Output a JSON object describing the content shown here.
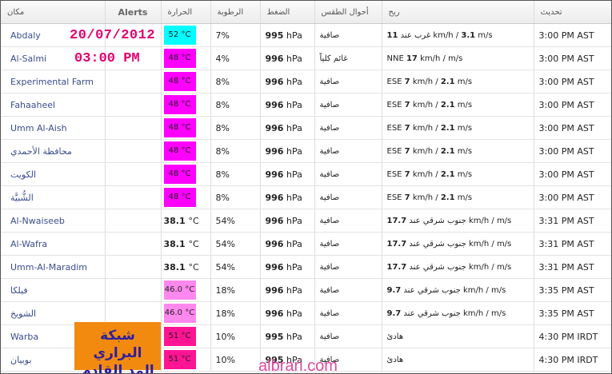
{
  "headers": {
    "place": "مكان",
    "alerts": "Alerts",
    "temp": "الحرارة",
    "humidity": "الرطوبة",
    "pressure": "الضغط",
    "conditions": "أحوال الطقس",
    "wind": "ريح",
    "updated": "تحديث"
  },
  "rows": [
    {
      "place": "Abdaly",
      "temp": "52",
      "temp_unit": "°C",
      "temp_style": "cyan",
      "humidity": "7%",
      "pressure": "995",
      "pressure_unit": "hPa",
      "conditions": "صافية",
      "wind_dir": "غرب عند",
      "wind_kmh": "11",
      "wind_ms": "3.1",
      "wind_dir_pos": "after",
      "updated": "3:00 PM AST"
    },
    {
      "place": "Al-Salmi",
      "temp": "48",
      "temp_unit": "°C",
      "temp_style": "magenta",
      "humidity": "4%",
      "pressure": "996",
      "pressure_unit": "hPa",
      "conditions": "غائم كلياً",
      "wind_dir": "NNE",
      "wind_kmh": "17",
      "wind_ms": "",
      "wind_dir_pos": "before",
      "updated": "3:00 PM AST"
    },
    {
      "place": "Experimental Farm",
      "temp": "48",
      "temp_unit": "°C",
      "temp_style": "magenta",
      "humidity": "8%",
      "pressure": "996",
      "pressure_unit": "hPa",
      "conditions": "صافية",
      "wind_dir": "ESE",
      "wind_kmh": "7",
      "wind_ms": "2.1",
      "wind_dir_pos": "before",
      "updated": "3:00 PM AST"
    },
    {
      "place": "Fahaaheel",
      "temp": "48",
      "temp_unit": "°C",
      "temp_style": "magenta",
      "humidity": "8%",
      "pressure": "996",
      "pressure_unit": "hPa",
      "conditions": "صافية",
      "wind_dir": "ESE",
      "wind_kmh": "7",
      "wind_ms": "2.1",
      "wind_dir_pos": "before",
      "updated": "3:00 PM AST"
    },
    {
      "place": "Umm Al-Aish",
      "temp": "48",
      "temp_unit": "°C",
      "temp_style": "magenta",
      "humidity": "8%",
      "pressure": "996",
      "pressure_unit": "hPa",
      "conditions": "صافية",
      "wind_dir": "ESE",
      "wind_kmh": "7",
      "wind_ms": "2.1",
      "wind_dir_pos": "before",
      "updated": "3:00 PM AST"
    },
    {
      "place": "محافظة الأحمدي",
      "temp": "48",
      "temp_unit": "°C",
      "temp_style": "magenta",
      "humidity": "8%",
      "pressure": "996",
      "pressure_unit": "hPa",
      "conditions": "صافية",
      "wind_dir": "ESE",
      "wind_kmh": "7",
      "wind_ms": "2.1",
      "wind_dir_pos": "before",
      "updated": "3:00 PM AST"
    },
    {
      "place": "الكويت",
      "temp": "48",
      "temp_unit": "°C",
      "temp_style": "magenta",
      "humidity": "8%",
      "pressure": "996",
      "pressure_unit": "hPa",
      "conditions": "صافية",
      "wind_dir": "ESE",
      "wind_kmh": "7",
      "wind_ms": "2.1",
      "wind_dir_pos": "before",
      "updated": "3:00 PM AST"
    },
    {
      "place": "الشُّبيَّة",
      "temp": "48",
      "temp_unit": "°C",
      "temp_style": "magenta",
      "humidity": "8%",
      "pressure": "996",
      "pressure_unit": "hPa",
      "conditions": "صافية",
      "wind_dir": "ESE",
      "wind_kmh": "7",
      "wind_ms": "2.1",
      "wind_dir_pos": "before",
      "updated": "3:00 PM AST"
    },
    {
      "place": "Al-Nwaiseeb",
      "temp": "38.1",
      "temp_unit": "°C",
      "temp_style": "plain",
      "humidity": "54%",
      "pressure": "996",
      "pressure_unit": "hPa",
      "conditions": "صافية",
      "wind_dir": "جنوب شرقي عند",
      "wind_kmh": "17.7",
      "wind_ms": "",
      "wind_dir_pos": "after",
      "updated": "3:31 PM AST"
    },
    {
      "place": "Al-Wafra",
      "temp": "38.1",
      "temp_unit": "°C",
      "temp_style": "plain",
      "humidity": "54%",
      "pressure": "996",
      "pressure_unit": "hPa",
      "conditions": "صافية",
      "wind_dir": "جنوب شرقي عند",
      "wind_kmh": "17.7",
      "wind_ms": "",
      "wind_dir_pos": "after",
      "updated": "3:31 PM AST"
    },
    {
      "place": "Umm-Al-Maradim",
      "temp": "38.1",
      "temp_unit": "°C",
      "temp_style": "plain",
      "humidity": "54%",
      "pressure": "996",
      "pressure_unit": "hPa",
      "conditions": "صافية",
      "wind_dir": "جنوب شرقي عند",
      "wind_kmh": "17.7",
      "wind_ms": "",
      "wind_dir_pos": "after",
      "updated": "3:31 PM AST"
    },
    {
      "place": "فيلكا",
      "temp": "46.0",
      "temp_unit": "°C",
      "temp_style": "pink",
      "humidity": "18%",
      "pressure": "996",
      "pressure_unit": "hPa",
      "conditions": "صافية",
      "wind_dir": "جنوب شرقي عند",
      "wind_kmh": "9.7",
      "wind_ms": "",
      "wind_dir_pos": "after",
      "updated": "3:35 PM AST"
    },
    {
      "place": "الشويخ",
      "temp": "46.0",
      "temp_unit": "°C",
      "temp_style": "pink",
      "humidity": "18%",
      "pressure": "996",
      "pressure_unit": "hPa",
      "conditions": "صافية",
      "wind_dir": "جنوب شرقي عند",
      "wind_kmh": "9.7",
      "wind_ms": "",
      "wind_dir_pos": "after",
      "updated": "3:35 PM AST"
    },
    {
      "place": "Warba",
      "temp": "51",
      "temp_unit": "°C",
      "temp_style": "red",
      "humidity": "10%",
      "pressure": "995",
      "pressure_unit": "hPa",
      "conditions": "صافية",
      "wind_dir": "هادئ",
      "wind_kmh": "",
      "wind_ms": "",
      "wind_dir_pos": "calm",
      "updated": "4:30 PM IRDT"
    },
    {
      "place": "بوبيان",
      "temp": "51",
      "temp_unit": "°C",
      "temp_style": "red",
      "humidity": "10%",
      "pressure": "995",
      "pressure_unit": "hPa",
      "conditions": "صافية",
      "wind_dir": "هادئ",
      "wind_kmh": "",
      "wind_ms": "",
      "wind_dir_pos": "calm",
      "updated": "4:30 PM IRDT"
    }
  ],
  "wind_units": {
    "kmh": "km/h",
    "ms": "m/s"
  },
  "overlay": {
    "date": "20/07/2012",
    "time": "03:00 PM",
    "logo_line1": "شبكة البراري",
    "logo_line2": "المد القادم",
    "watermark": "albrari.com"
  },
  "colors": {
    "cyan": "#00ffff",
    "magenta": "#ff00ff",
    "pink": "#ff88ee",
    "red": "#ff1493"
  }
}
